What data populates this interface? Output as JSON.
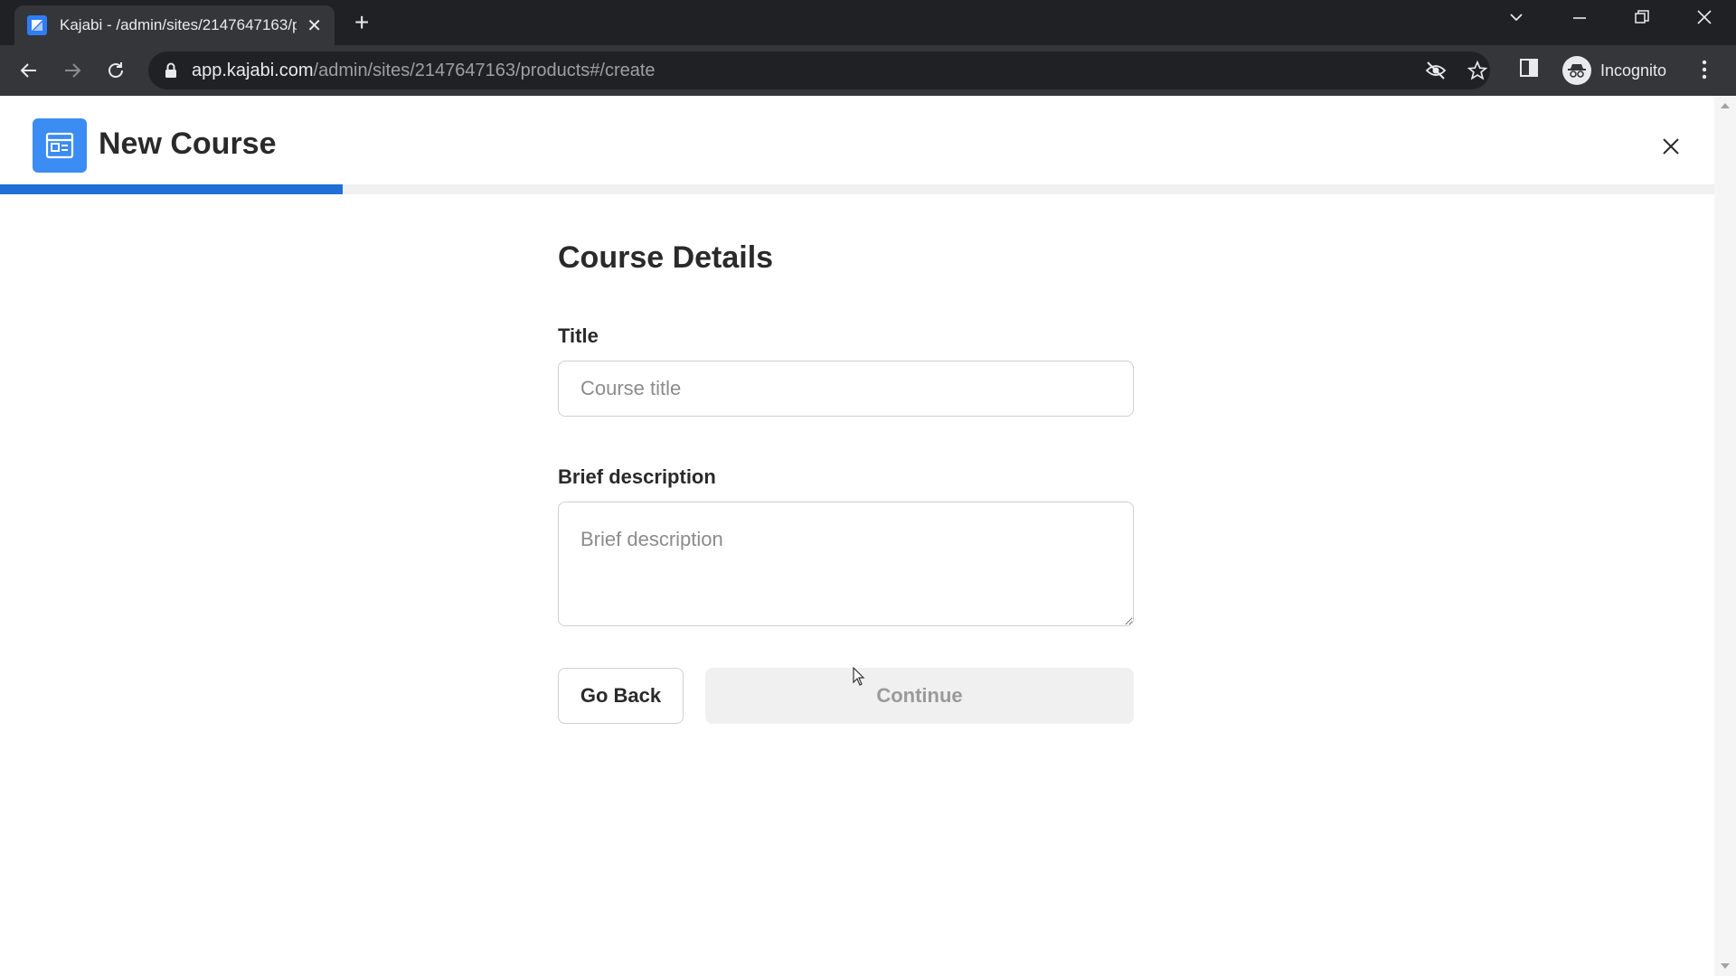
{
  "browser": {
    "tab_title": "Kajabi - /admin/sites/2147647163/products",
    "tab_favicon": "kajabi-logo-icon",
    "url_host": "app.kajabi.com",
    "url_path": "/admin/sites/2147647163/products#/create",
    "profile_label": "Incognito"
  },
  "header": {
    "title": "New Course",
    "icon": "course-builder-icon"
  },
  "progress": {
    "fraction": 0.2
  },
  "form": {
    "heading": "Course Details",
    "title_label": "Title",
    "title_placeholder": "Course title",
    "title_value": "",
    "description_label": "Brief description",
    "description_placeholder": "Brief description",
    "description_value": "",
    "go_back_label": "Go Back",
    "continue_label": "Continue"
  },
  "colors": {
    "accent": "#1f6fd6",
    "icon_bg": "#3b8cf3",
    "continue_disabled_bg": "#f0f0f0"
  }
}
